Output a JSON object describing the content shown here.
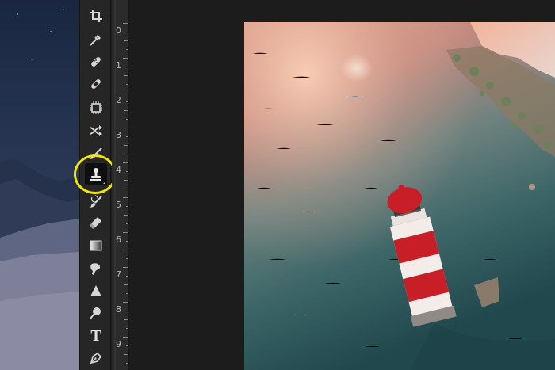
{
  "colors": {
    "toolbar_bg": "#262626",
    "ruler_bg": "#2b2b2b",
    "canvas_bg": "#1c1c1c",
    "highlight_ring": "#f2e600",
    "lighthouse_red": "#c81e28"
  },
  "toolbar": {
    "tools": [
      {
        "icon": "crop-icon"
      },
      {
        "icon": "eyedropper-icon"
      },
      {
        "icon": "spot-healing-brush-icon"
      },
      {
        "icon": "healing-bandage-icon"
      },
      {
        "icon": "content-aware-icon"
      },
      {
        "icon": "red-eye-swap-icon"
      },
      {
        "icon": "brush-icon"
      },
      {
        "icon": "clone-stamp-icon",
        "active": true
      },
      {
        "icon": "history-brush-icon"
      },
      {
        "icon": "eraser-icon"
      },
      {
        "icon": "gradient-icon"
      },
      {
        "icon": "smudge-icon"
      },
      {
        "icon": "sharpen-icon"
      },
      {
        "icon": "dodge-icon"
      },
      {
        "icon": "type-icon",
        "glyph": "T"
      },
      {
        "icon": "pen-icon"
      }
    ]
  },
  "ruler": {
    "labels": [
      "0",
      "1",
      "2",
      "3",
      "4",
      "5",
      "6",
      "7",
      "8",
      "9"
    ]
  }
}
